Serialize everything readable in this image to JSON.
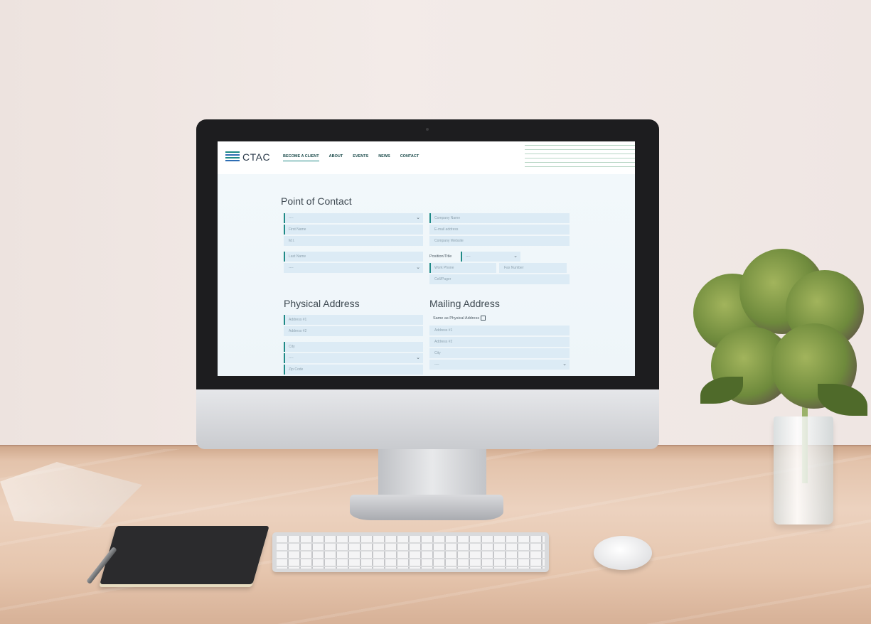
{
  "site": {
    "logo_text": "CTAC",
    "nav": [
      {
        "label": "BECOME A CLIENT",
        "active": true
      },
      {
        "label": "ABOUT",
        "active": false
      },
      {
        "label": "EVENTS",
        "active": false
      },
      {
        "label": "NEWS",
        "active": false
      },
      {
        "label": "CONTACT",
        "active": false
      }
    ]
  },
  "form": {
    "point_of_contact": {
      "title": "Point of Contact",
      "prefix_select": "----",
      "first_name": "First Name",
      "mi": "M.I.",
      "last_name": "Last Name",
      "suffix_select": "----",
      "company_name": "Company Name",
      "email": "E-mail address",
      "company_website": "Company Website",
      "position_label": "Position/Title",
      "position_select": "----",
      "work_phone": "Work Phone",
      "fax_number": "Fax Number",
      "cell_pager": "Cell/Pager"
    },
    "physical_address": {
      "title": "Physical Address",
      "address1": "Address #1",
      "address2": "Address #2",
      "city": "City",
      "state_select": "----",
      "zip": "Zip Code"
    },
    "mailing_address": {
      "title": "Mailing Address",
      "same_as_label": "Same as Physical Address",
      "address1": "Address #1",
      "address2": "Address #2",
      "city": "City",
      "state_select": "----"
    }
  }
}
